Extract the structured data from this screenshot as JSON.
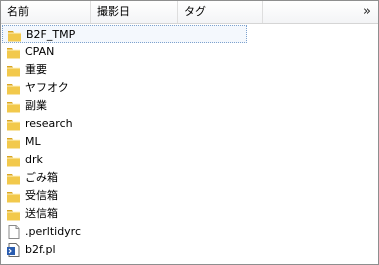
{
  "header": {
    "columns": [
      "名前",
      "撮影日",
      "タグ"
    ],
    "more": "»"
  },
  "files": [
    {
      "name": "B2F_TMP",
      "type": "folder",
      "selected": true
    },
    {
      "name": "CPAN",
      "type": "folder"
    },
    {
      "name": "重要",
      "type": "folder"
    },
    {
      "name": "ヤフオク",
      "type": "folder"
    },
    {
      "name": "副業",
      "type": "folder"
    },
    {
      "name": "research",
      "type": "folder"
    },
    {
      "name": "ML",
      "type": "folder"
    },
    {
      "name": "drk",
      "type": "folder"
    },
    {
      "name": "ごみ箱",
      "type": "folder"
    },
    {
      "name": "受信箱",
      "type": "folder"
    },
    {
      "name": "送信箱",
      "type": "folder"
    },
    {
      "name": ".perltidyrc",
      "type": "file"
    },
    {
      "name": "b2f.pl",
      "type": "script"
    }
  ],
  "colors": {
    "folder_front": "#f2c94c",
    "folder_back": "#d9a520",
    "selection_border": "#7da2ce"
  }
}
